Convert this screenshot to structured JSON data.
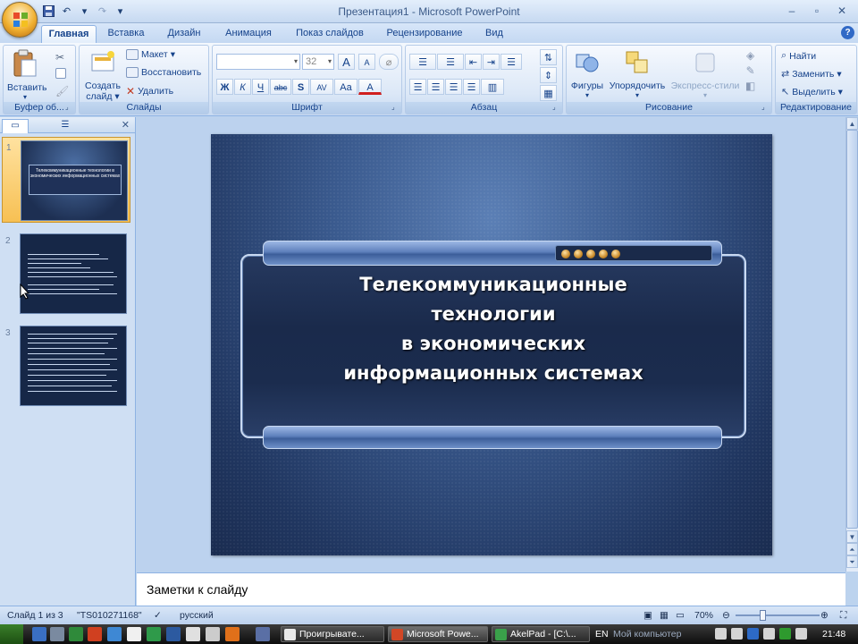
{
  "window": {
    "title": "Презентация1 - Microsoft PowerPoint",
    "controls": [
      "minimize",
      "maximize",
      "close"
    ]
  },
  "qat": {
    "icons": [
      "save-icon",
      "undo-icon",
      "redo-icon",
      "customize-icon"
    ]
  },
  "tabs": [
    {
      "label": "Главная",
      "active": true
    },
    {
      "label": "Вставка"
    },
    {
      "label": "Дизайн"
    },
    {
      "label": "Анимация"
    },
    {
      "label": "Показ слайдов"
    },
    {
      "label": "Рецензирование"
    },
    {
      "label": "Вид"
    }
  ],
  "ribbon": {
    "clipboard": {
      "label": "Буфер об...",
      "paste": "Вставить"
    },
    "slides": {
      "label": "Слайды",
      "new_slide_1": "Создать",
      "new_slide_2": "слайд",
      "layout": "Макет",
      "reset": "Восстановить",
      "delete": "Удалить"
    },
    "font": {
      "label": "Шрифт",
      "font_name": "",
      "font_size": "32",
      "bold": "Ж",
      "italic": "К",
      "underline": "Ч",
      "strike": "abc",
      "shadow": "S",
      "spacing": "AV",
      "case": "Aa",
      "color": "A",
      "grow": "A",
      "shrink": "A"
    },
    "paragraph": {
      "label": "Абзац"
    },
    "drawing": {
      "label": "Рисование",
      "shapes": "Фигуры",
      "arrange": "Упорядочить",
      "styles": "Экспресс-стили"
    },
    "editing": {
      "label": "Редактирование",
      "find": "Найти",
      "replace": "Заменить",
      "select": "Выделить"
    }
  },
  "left_panel": {
    "tabs": [
      "slides",
      "outline"
    ],
    "thumbnails": [
      {
        "num": "1",
        "selected": true,
        "text": "Телекоммуникационные технологии в экономических информационных системах"
      },
      {
        "num": "2",
        "selected": false
      },
      {
        "num": "3",
        "selected": false
      }
    ]
  },
  "slide": {
    "title_lines": [
      "Телекоммуникационные",
      "технологии",
      "в экономических",
      "информационных системах"
    ]
  },
  "notes": {
    "placeholder": "Заметки к слайду"
  },
  "status": {
    "slide_info": "Слайд 1 из 3",
    "theme": "\"TS010271168\"",
    "language": "русский",
    "zoom": "70%"
  },
  "taskbar": {
    "tasks": [
      {
        "label": "Проигрывате..."
      },
      {
        "label": "Microsoft Powe...",
        "active": true
      },
      {
        "label": "AkelPad - [C:\\..."
      }
    ],
    "lang": "EN",
    "computer": "Мой компьютер",
    "clock": "21:48"
  },
  "colors": {
    "ribbon_text": "#15428b",
    "slide_bg": "#203660",
    "selected_thumb": "#f7c053"
  }
}
